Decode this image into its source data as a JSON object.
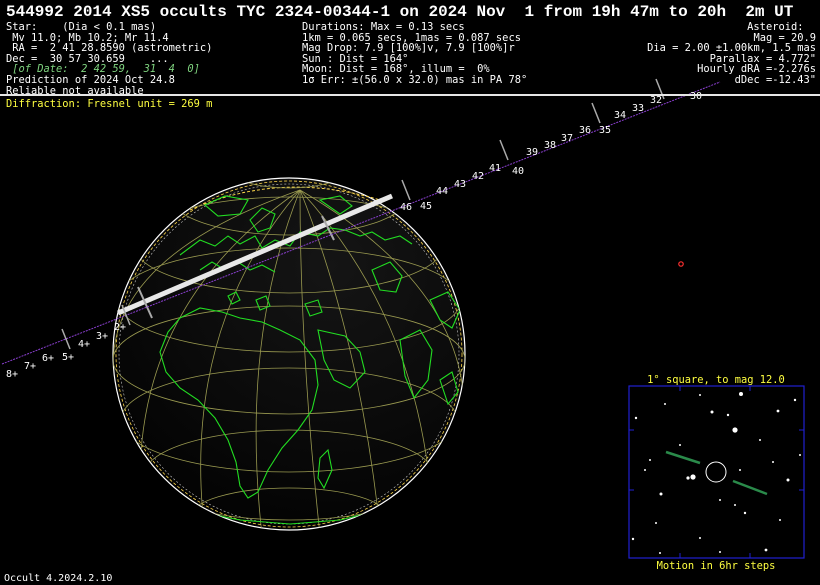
{
  "title": "544992 2014 XS5 occults TYC 2324-00344-1 on 2024 Nov  1 from 19h 47m to 20h  2m UT",
  "star": {
    "line1": "Star:    (Dia < 0.1 mas)",
    "line2": " Mv 11.0; Mb 10.2; Mr 11.4",
    "line3": " RA =  2 41 28.8590 (astrometric)",
    "line4": "Dec =  30 57 30.659    ...",
    "line5": " [of Date:  2 42 59,  31  4  0]",
    "line6": "Prediction of 2024 Oct 24.8",
    "line7": "Reliable not available"
  },
  "event": {
    "line1": "Durations: Max = 0.13 secs",
    "line2": "1km = 0.065 secs, 1mas = 0.087 secs",
    "line3": "Mag Drop: 7.9 [100%]v, 7.9 [100%]r",
    "line4": "Sun : Dist = 164°",
    "line5": "Moon: Dist = 168°, illum =  0%",
    "line6": "1σ Err: ±(56.0 x 32.0) mas in PA 78°"
  },
  "asteroid": {
    "line1": "Asteroid:  ",
    "line2": "Mag = 20.9",
    "line3": "Dia = 2.00 ±1.00km, 1.5 mas",
    "line4": "Parallax = 4.772\"",
    "line5": "Hourly dRA =-2.276s",
    "line6": "dDec =-12.43\""
  },
  "diffraction": "Diffraction: Fresnel unit = 269 m",
  "track_labels": [
    "8+",
    "7+",
    "6+",
    "5+",
    "4+",
    "3+",
    "2+",
    "46",
    "45",
    "44",
    "43",
    "42",
    "41",
    "40",
    "39",
    "38",
    "37",
    "36",
    "35",
    "34",
    "33",
    "32",
    "30"
  ],
  "inset": {
    "title": "1° square, to mag 12.0",
    "caption": "Motion in 6hr steps"
  },
  "footer": "Occult 4.2024.2.10",
  "colors": {
    "background": "#000000",
    "land": "#22dd22",
    "grid": "#9a9a50",
    "path": "#e0e0e0",
    "track": "#8a3fd0",
    "highlight": "#ffff40",
    "inset_border": "#2020d0"
  }
}
